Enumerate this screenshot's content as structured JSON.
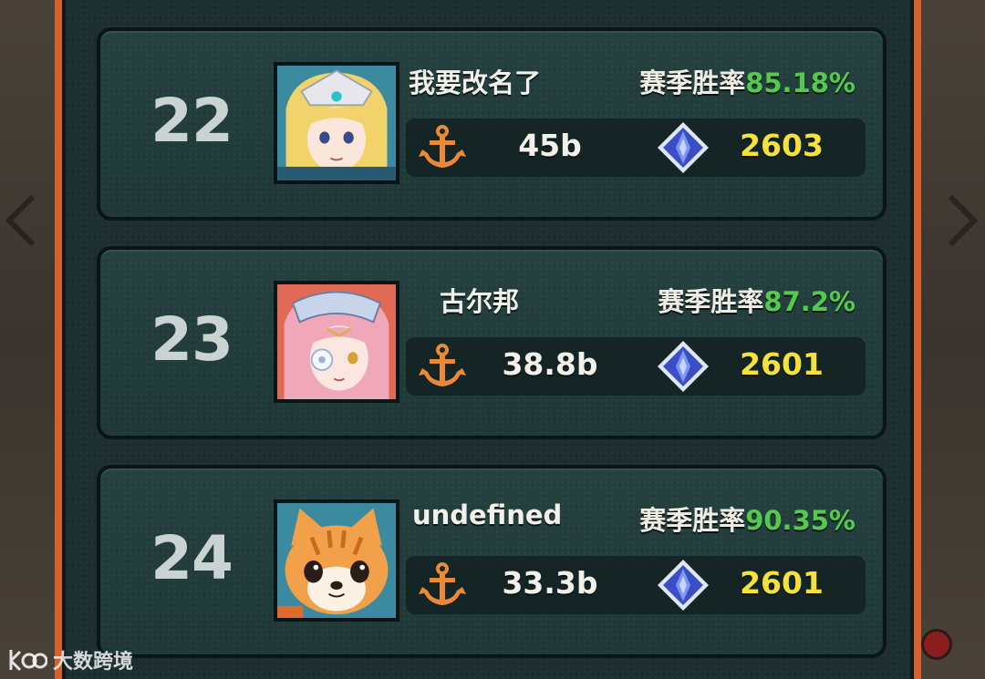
{
  "leaderboard": {
    "rows": [
      {
        "rank": "22",
        "name": "我要改名了",
        "winrate_label": "赛季胜率",
        "winrate_value": "85.18%",
        "power": "45b",
        "score": "2603",
        "avatar": "blonde-girl-avatar"
      },
      {
        "rank": "23",
        "name": "古尔邦",
        "winrate_label": "赛季胜率",
        "winrate_value": "87.2%",
        "power": "38.8b",
        "score": "2601",
        "avatar": "pink-hair-girl-avatar"
      },
      {
        "rank": "24",
        "name": "undefined",
        "winrate_label": "赛季胜率",
        "winrate_value": "90.35%",
        "power": "33.3b",
        "score": "2601",
        "avatar": "orange-cat-avatar"
      }
    ],
    "icons": {
      "power": "anchor-icon",
      "score": "crystal-gem-icon"
    }
  },
  "watermark": {
    "text": "大数跨境"
  },
  "colors": {
    "frame_orange": "#d4622e",
    "row_bg": "#24403f",
    "winrate_green": "#55c94e",
    "score_yellow": "#f3e23a"
  }
}
